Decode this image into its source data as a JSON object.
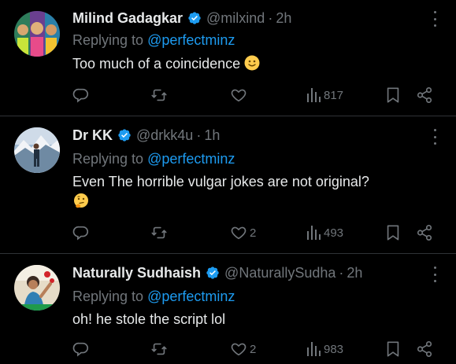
{
  "tweets": [
    {
      "name": "Milind Gadagkar",
      "handle": "@milxind",
      "time": "2h",
      "replying_prefix": "Replying to ",
      "replying_to": "@perfectminz",
      "text": "Too much of a coincidence",
      "emoji": "slightly-smiling-face",
      "replies": "",
      "retweets": "",
      "likes": "",
      "views": "817"
    },
    {
      "name": "Dr KK",
      "handle": "@drkk4u",
      "time": "1h",
      "replying_prefix": "Replying to ",
      "replying_to": "@perfectminz",
      "text": "Even The horrible vulgar jokes are not original?",
      "emoji": "thinking-face",
      "replies": "",
      "retweets": "",
      "likes": "2",
      "views": "493"
    },
    {
      "name": "Naturally Sudhaish",
      "handle": "@NaturallySudha",
      "time": "2h",
      "replying_prefix": "Replying to ",
      "replying_to": "@perfectminz",
      "text": "oh! he stole the script lol",
      "emoji": "",
      "replies": "",
      "retweets": "",
      "likes": "2",
      "views": "983"
    }
  ],
  "separator": "·",
  "colors": {
    "background": "#000000",
    "text": "#e7e9ea",
    "muted": "#71767b",
    "link": "#1d9bf0",
    "verified": "#1d9bf0",
    "divider": "#2f3336"
  },
  "icons": [
    "verified-badge-icon",
    "more-icon",
    "reply-icon",
    "retweet-icon",
    "like-icon",
    "views-icon",
    "bookmark-icon",
    "share-icon"
  ]
}
